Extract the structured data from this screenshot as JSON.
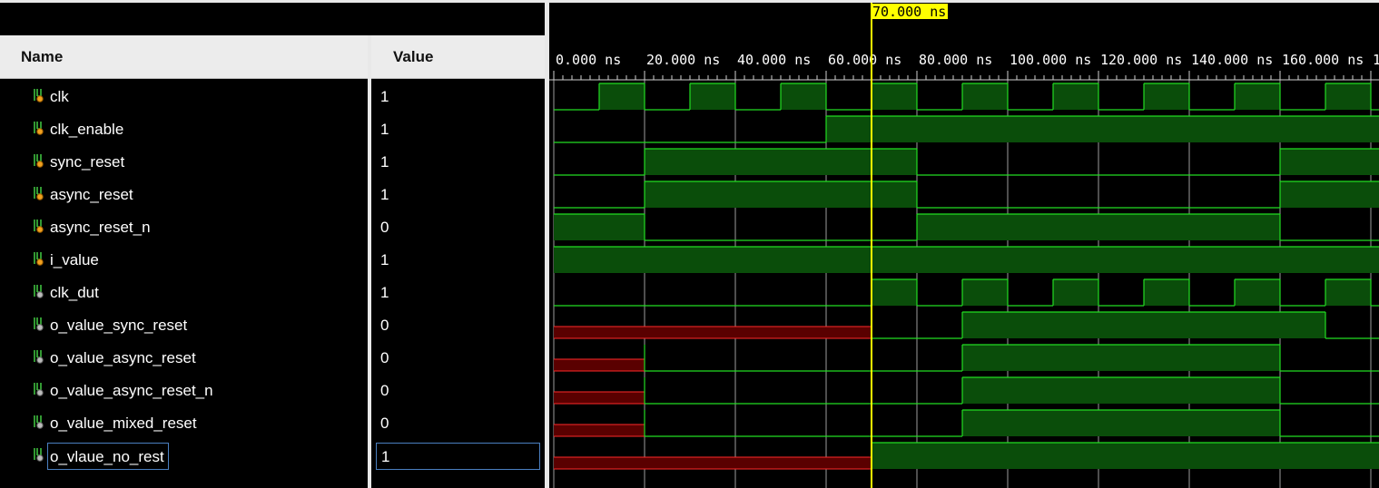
{
  "window": {
    "title": ""
  },
  "headers": {
    "name": "Name",
    "value": "Value"
  },
  "signals": [
    {
      "name": "clk",
      "value": "1",
      "kind": "input",
      "selected": false
    },
    {
      "name": "clk_enable",
      "value": "1",
      "kind": "input",
      "selected": false
    },
    {
      "name": "sync_reset",
      "value": "1",
      "kind": "input",
      "selected": false
    },
    {
      "name": "async_reset",
      "value": "1",
      "kind": "input",
      "selected": false
    },
    {
      "name": "async_reset_n",
      "value": "0",
      "kind": "input",
      "selected": false
    },
    {
      "name": "i_value",
      "value": "1",
      "kind": "input",
      "selected": false
    },
    {
      "name": "clk_dut",
      "value": "1",
      "kind": "output",
      "selected": false
    },
    {
      "name": "o_value_sync_reset",
      "value": "0",
      "kind": "output",
      "selected": false
    },
    {
      "name": "o_value_async_reset",
      "value": "0",
      "kind": "output",
      "selected": false
    },
    {
      "name": "o_value_async_reset_n",
      "value": "0",
      "kind": "output",
      "selected": false
    },
    {
      "name": "o_value_mixed_reset",
      "value": "0",
      "kind": "output",
      "selected": false
    },
    {
      "name": "o_vlaue_no_rest",
      "value": "1",
      "kind": "output",
      "selected": true
    }
  ],
  "timeline": {
    "unit": "ns",
    "tick_labels": [
      "0.000 ns",
      "20.000 ns",
      "40.000 ns",
      "60.000 ns",
      "80.000 ns",
      "100.000 ns",
      "120.000 ns",
      "140.000 ns",
      "160.000 ns",
      "1"
    ],
    "label_times": [
      0,
      20,
      40,
      60,
      80,
      100,
      120,
      140,
      160,
      180
    ],
    "cursor_time": 70,
    "cursor_label": "70.000 ns",
    "view_start": 0,
    "view_end": 182
  },
  "waveforms": [
    {
      "segments": [
        [
          0,
          10,
          0
        ],
        [
          10,
          20,
          1
        ],
        [
          20,
          30,
          0
        ],
        [
          30,
          40,
          1
        ],
        [
          40,
          50,
          0
        ],
        [
          50,
          60,
          1
        ],
        [
          60,
          70,
          0
        ],
        [
          70,
          80,
          1
        ],
        [
          80,
          90,
          0
        ],
        [
          90,
          100,
          1
        ],
        [
          100,
          110,
          0
        ],
        [
          110,
          120,
          1
        ],
        [
          120,
          130,
          0
        ],
        [
          130,
          140,
          1
        ],
        [
          140,
          150,
          0
        ],
        [
          150,
          160,
          1
        ],
        [
          160,
          170,
          0
        ],
        [
          170,
          180,
          1
        ],
        [
          180,
          182,
          0
        ]
      ]
    },
    {
      "segments": [
        [
          0,
          60,
          0
        ],
        [
          60,
          182,
          1
        ]
      ]
    },
    {
      "segments": [
        [
          0,
          20,
          0
        ],
        [
          20,
          80,
          1
        ],
        [
          80,
          160,
          0
        ],
        [
          160,
          182,
          1
        ]
      ]
    },
    {
      "segments": [
        [
          0,
          20,
          0
        ],
        [
          20,
          80,
          1
        ],
        [
          80,
          160,
          0
        ],
        [
          160,
          182,
          1
        ]
      ]
    },
    {
      "segments": [
        [
          0,
          20,
          1
        ],
        [
          20,
          80,
          0
        ],
        [
          80,
          160,
          1
        ],
        [
          160,
          182,
          0
        ]
      ]
    },
    {
      "segments": [
        [
          0,
          182,
          1
        ]
      ]
    },
    {
      "segments": [
        [
          0,
          70,
          0
        ],
        [
          70,
          80,
          1
        ],
        [
          80,
          90,
          0
        ],
        [
          90,
          100,
          1
        ],
        [
          100,
          110,
          0
        ],
        [
          110,
          120,
          1
        ],
        [
          120,
          130,
          0
        ],
        [
          130,
          140,
          1
        ],
        [
          140,
          150,
          0
        ],
        [
          150,
          160,
          1
        ],
        [
          160,
          170,
          0
        ],
        [
          170,
          180,
          1
        ],
        [
          180,
          182,
          0
        ]
      ]
    },
    {
      "segments": [
        [
          0,
          70,
          "X"
        ],
        [
          70,
          90,
          0
        ],
        [
          90,
          170,
          1
        ],
        [
          170,
          182,
          0
        ]
      ]
    },
    {
      "segments": [
        [
          0,
          20,
          "X"
        ],
        [
          20,
          90,
          0
        ],
        [
          90,
          160,
          1
        ],
        [
          160,
          182,
          0
        ]
      ]
    },
    {
      "segments": [
        [
          0,
          20,
          "X"
        ],
        [
          20,
          90,
          0
        ],
        [
          90,
          160,
          1
        ],
        [
          160,
          182,
          0
        ]
      ]
    },
    {
      "segments": [
        [
          0,
          20,
          "X"
        ],
        [
          20,
          90,
          0
        ],
        [
          90,
          160,
          1
        ],
        [
          160,
          182,
          0
        ]
      ]
    },
    {
      "segments": [
        [
          0,
          70,
          "X"
        ],
        [
          70,
          182,
          1
        ]
      ]
    }
  ],
  "colors": {
    "wave_high_fill": "#0a4d0a",
    "wave_line": "#22dd22",
    "wave_x_fill": "#5a0000",
    "wave_x_line": "#ff2a2a",
    "cursor": "#ffff00",
    "grid": "#cfcfcf",
    "background": "#000000"
  }
}
